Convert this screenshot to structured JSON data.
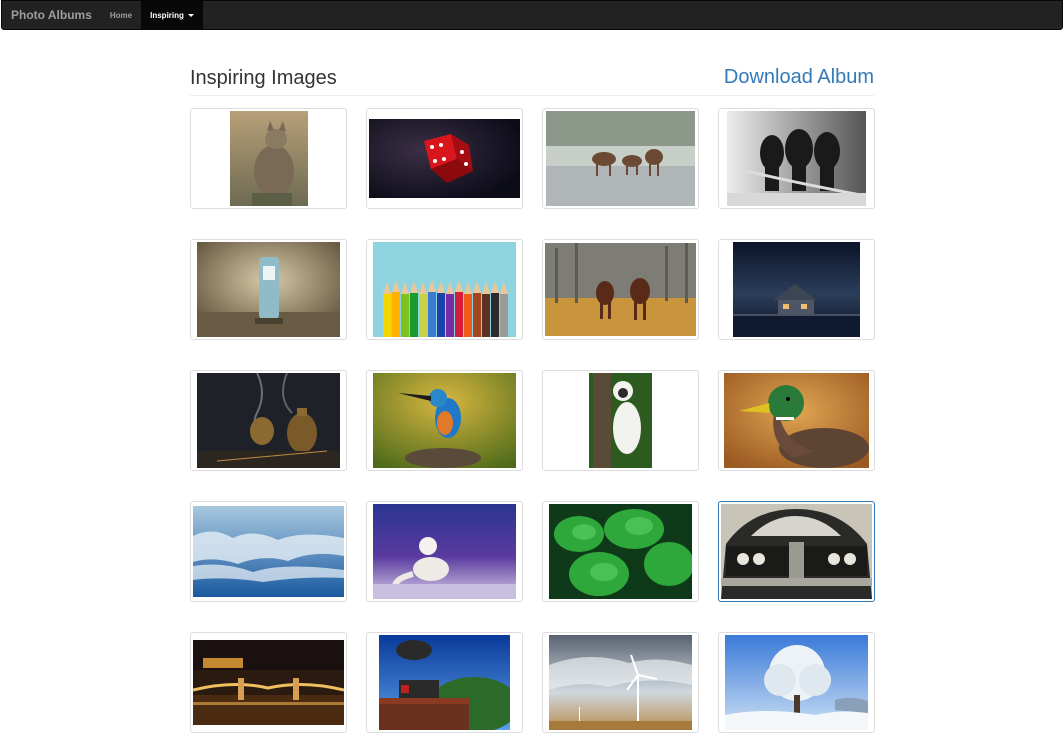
{
  "navbar": {
    "brand": "Photo Albums",
    "items": [
      {
        "label": "Home",
        "active": false
      },
      {
        "label": "Inspiring",
        "active": true,
        "dropdown": true
      }
    ]
  },
  "page": {
    "title": "Inspiring Images",
    "download_label": "Download Album"
  },
  "photos": [
    {
      "name": "cat"
    },
    {
      "name": "red-dice"
    },
    {
      "name": "deer-in-frost"
    },
    {
      "name": "firefighters"
    },
    {
      "name": "gas-pump"
    },
    {
      "name": "colored-pencils"
    },
    {
      "name": "horses"
    },
    {
      "name": "lake-house-night"
    },
    {
      "name": "incense-vase"
    },
    {
      "name": "kingfisher"
    },
    {
      "name": "lemur"
    },
    {
      "name": "mallard-duck"
    },
    {
      "name": "clouds-above"
    },
    {
      "name": "arctic-fox"
    },
    {
      "name": "pine-branches"
    },
    {
      "name": "vintage-car"
    },
    {
      "name": "chain-bridge-night"
    },
    {
      "name": "steam-train"
    },
    {
      "name": "wind-turbines"
    },
    {
      "name": "frosted-tree"
    }
  ]
}
